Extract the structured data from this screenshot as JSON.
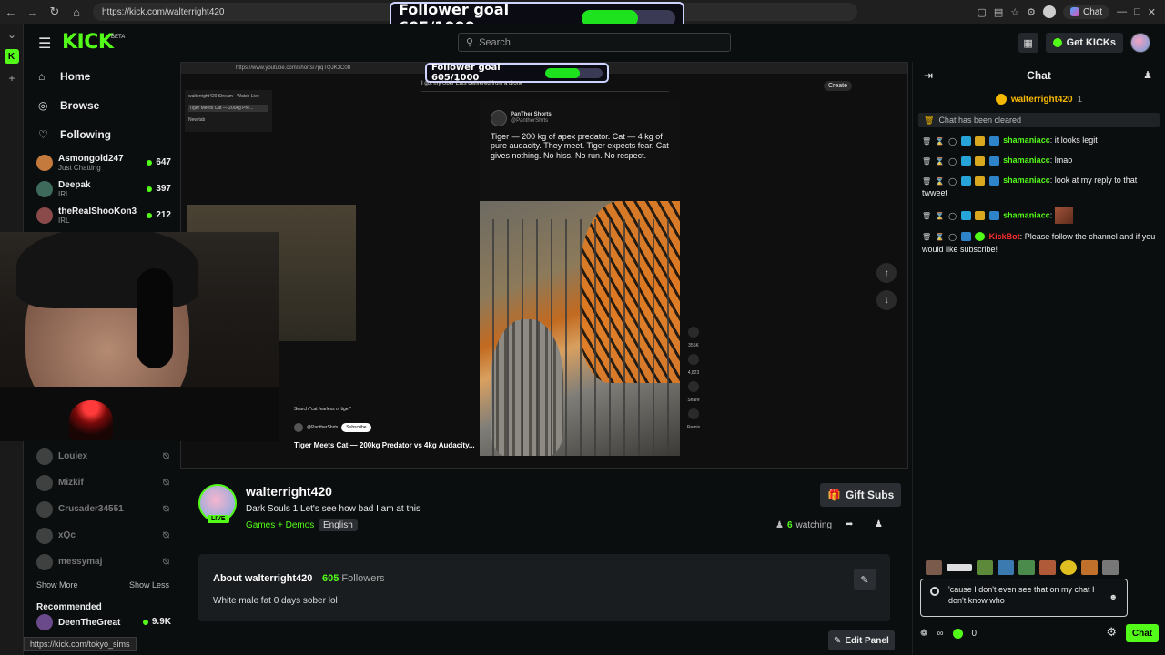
{
  "browser": {
    "url": "https://kick.com/walterright420",
    "copilot_label": "Chat"
  },
  "goal": {
    "text": "Follower goal 605/1000",
    "progress": 0.605
  },
  "nav": {
    "search_placeholder": "Search",
    "get_kicks": "Get KICKs",
    "logo": "KICK",
    "logo_sup": "BETA"
  },
  "sidebar": {
    "home": "Home",
    "browse": "Browse",
    "following": "Following",
    "live": [
      {
        "name": "Asmongold247",
        "category": "Just Chatting",
        "viewers": "647"
      },
      {
        "name": "Deepak",
        "category": "IRL",
        "viewers": "397"
      },
      {
        "name": "theRealShooKon3",
        "category": "IRL",
        "viewers": "212"
      }
    ],
    "offline": [
      "Louiex",
      "Mizkif",
      "Crusader34551",
      "xQc",
      "messymaj"
    ],
    "show_more": "Show More",
    "show_less": "Show Less",
    "recommended": "Recommended",
    "rec": {
      "name": "DeenTheGreat",
      "viewers": "9.9K"
    }
  },
  "video": {
    "inner_url": "https://www.youtube.com/shorts/7pqTQJK3C08",
    "inner_search": "I got my Uber Eats delivered from a drone",
    "tweet_author": "PanTher Shorts",
    "tweet_handle": "@PantherShrts",
    "tweet_text": "Tiger — 200 kg of apex predator. Cat — 4 kg of pure audacity. They meet. Tiger expects fear. Cat gives nothing. No hiss. No run. No respect.",
    "short_search": "Search \"cat fearless of tiger\"",
    "short_channel": "@PantherShrts",
    "subscribe": "Subscribe",
    "short_title": "Tiger Meets Cat — 200kg Predator vs 4kg Audacity...",
    "likes": "355K",
    "comments": "4,823",
    "share": "Share",
    "remix": "Remix",
    "tab1": "walterright420 Stream - Watch Live",
    "tab2": "Tiger Meets Cat — 200kg Pre...",
    "new_tab": "New tab",
    "create": "Create"
  },
  "stream": {
    "name": "walterright420",
    "live": "LIVE",
    "title": "Dark Souls 1 Let's see how bad I am at this",
    "category": "Games + Demos",
    "language": "English",
    "gift_subs": "Gift Subs",
    "watching_count": "6",
    "watching_label": "watching"
  },
  "about": {
    "heading": "About walterright420",
    "followers_count": "605",
    "followers_label": "Followers",
    "body": "White male fat 0 days sober lol",
    "edit_panel": "Edit Panel"
  },
  "status_url": "https://kick.com/tokyo_sims",
  "chat": {
    "title": "Chat",
    "pinned_user": "walterright420",
    "pinned_count": "1",
    "cleared": "Chat has been cleared",
    "messages": [
      {
        "user": "shamaniacc",
        "text": "it looks legit"
      },
      {
        "user": "shamaniacc",
        "text": "lmao"
      },
      {
        "user": "shamaniacc",
        "text": "look at my reply to that twweet"
      },
      {
        "user": "shamaniacc",
        "text": ""
      },
      {
        "user": "KickBot",
        "text": "Please follow the channel and if you would like subscribe!"
      }
    ],
    "input_text": "'cause I don't even see that on my chat I don't know who",
    "points": "0",
    "send": "Chat"
  }
}
